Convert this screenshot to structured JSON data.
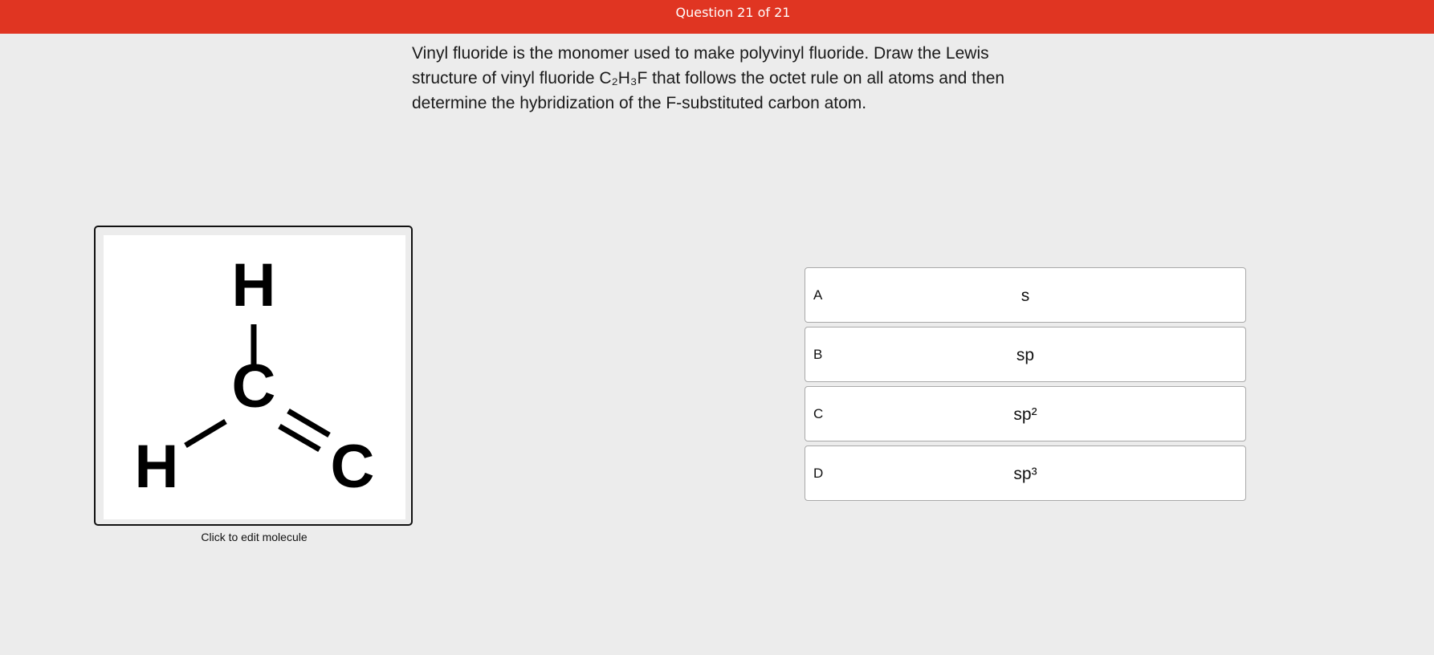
{
  "header": {
    "title": "Question 21 of 21",
    "color": "#e03522"
  },
  "question": {
    "text": "Vinyl fluoride is the monomer used to make polyvinyl fluoride. Draw the Lewis structure of vinyl fluoride C₂H₃F that follows the octet rule on all atoms and then determine the hybridization of the F-substituted carbon atom."
  },
  "molecule_editor": {
    "atoms": {
      "top_h": "H",
      "left_h": "H",
      "center_c": "C",
      "right_c": "C"
    },
    "caption": "Click to edit molecule"
  },
  "choices": [
    {
      "letter": "A",
      "answer": "s"
    },
    {
      "letter": "B",
      "answer": "sp"
    },
    {
      "letter": "C",
      "answer": "sp²"
    },
    {
      "letter": "D",
      "answer": "sp³"
    }
  ]
}
